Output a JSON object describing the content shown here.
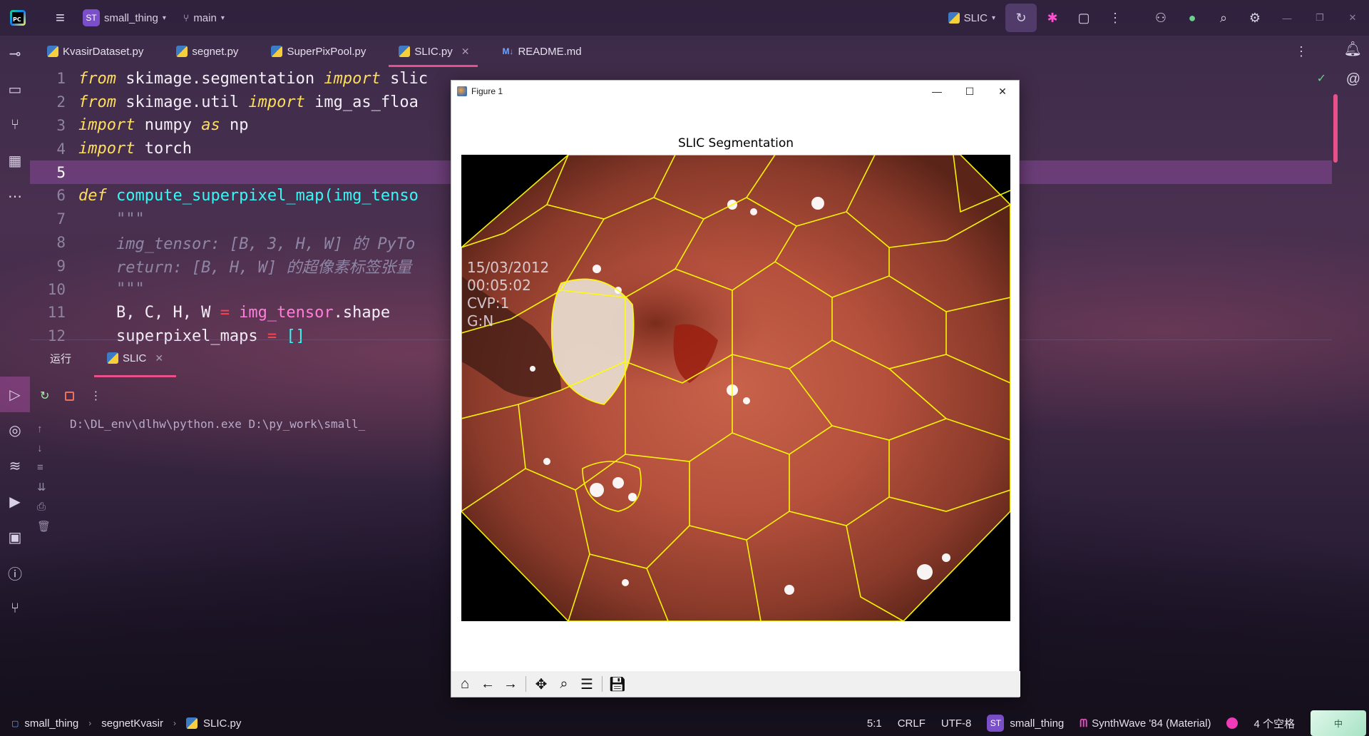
{
  "titlebar": {
    "project_badge": "ST",
    "project_name": "small_thing",
    "branch": "main",
    "run_config": "SLIC"
  },
  "tabs": [
    {
      "label": "KvasirDataset.py",
      "type": "py"
    },
    {
      "label": "segnet.py",
      "type": "py"
    },
    {
      "label": "SuperPixPool.py",
      "type": "py"
    },
    {
      "label": "SLIC.py",
      "type": "py",
      "active": true
    },
    {
      "label": "README.md",
      "type": "md"
    }
  ],
  "editor": {
    "lines": [
      {
        "n": "1"
      },
      {
        "n": "2"
      },
      {
        "n": "3"
      },
      {
        "n": "4"
      },
      {
        "n": "5"
      },
      {
        "n": "6"
      },
      {
        "n": "7"
      },
      {
        "n": "8"
      },
      {
        "n": "9"
      },
      {
        "n": "10"
      },
      {
        "n": "11"
      },
      {
        "n": "12"
      }
    ],
    "code": {
      "l1_kw1": "from",
      "l1_mod": " skimage.segmentation ",
      "l1_kw2": "import",
      "l1_rest": " slic",
      "l2_kw1": "from",
      "l2_mod": " skimage.util ",
      "l2_kw2": "import",
      "l2_rest": " img_as_floa",
      "l3_kw1": "import",
      "l3_mod": " numpy ",
      "l3_kw2": "as",
      "l3_rest": " np",
      "l4_kw1": "import",
      "l4_rest": " torch",
      "l6_def": "def",
      "l6_fn": " compute_superpixel_map(img_tenso",
      "l7_doc": "    \"\"\"",
      "l8_doc": "    img_tensor: [B, 3, H, W] 的 PyTo",
      "l9_doc": "    return: [B, H, W] 的超像素标签张量",
      "l10_doc": "    \"\"\"",
      "l11_a": "    B, C, H, W ",
      "l11_op": "=",
      "l11_var": " img_tensor",
      "l11_b": ".shape",
      "l12_a": "    superpixel_maps ",
      "l12_op": "=",
      "l12_brk": " []"
    }
  },
  "run_panel": {
    "label": "运行",
    "tab": "SLIC",
    "output": "D:\\DL_env\\dlhw\\python.exe D:\\py_work\\small_"
  },
  "statusbar": {
    "crumbs": [
      "small_thing",
      "segnetKvasir",
      "SLIC.py"
    ],
    "position": "5:1",
    "line_sep": "CRLF",
    "encoding": "UTF-8",
    "interp_badge": "ST",
    "interpreter": "small_thing",
    "theme": "SynthWave '84 (Material)",
    "indent": "4 个空格",
    "ime": "中"
  },
  "figure": {
    "window_title": "Figure 1",
    "plot_title": "SLIC Segmentation",
    "overlay_text": [
      "15/03/2012",
      "00:05:02",
      "CVP:1",
      "G:N"
    ]
  },
  "colors": {
    "accent": "#e8508a",
    "keyword": "#fede5d",
    "function": "#36f9f6",
    "boundary": "#ffff00"
  }
}
